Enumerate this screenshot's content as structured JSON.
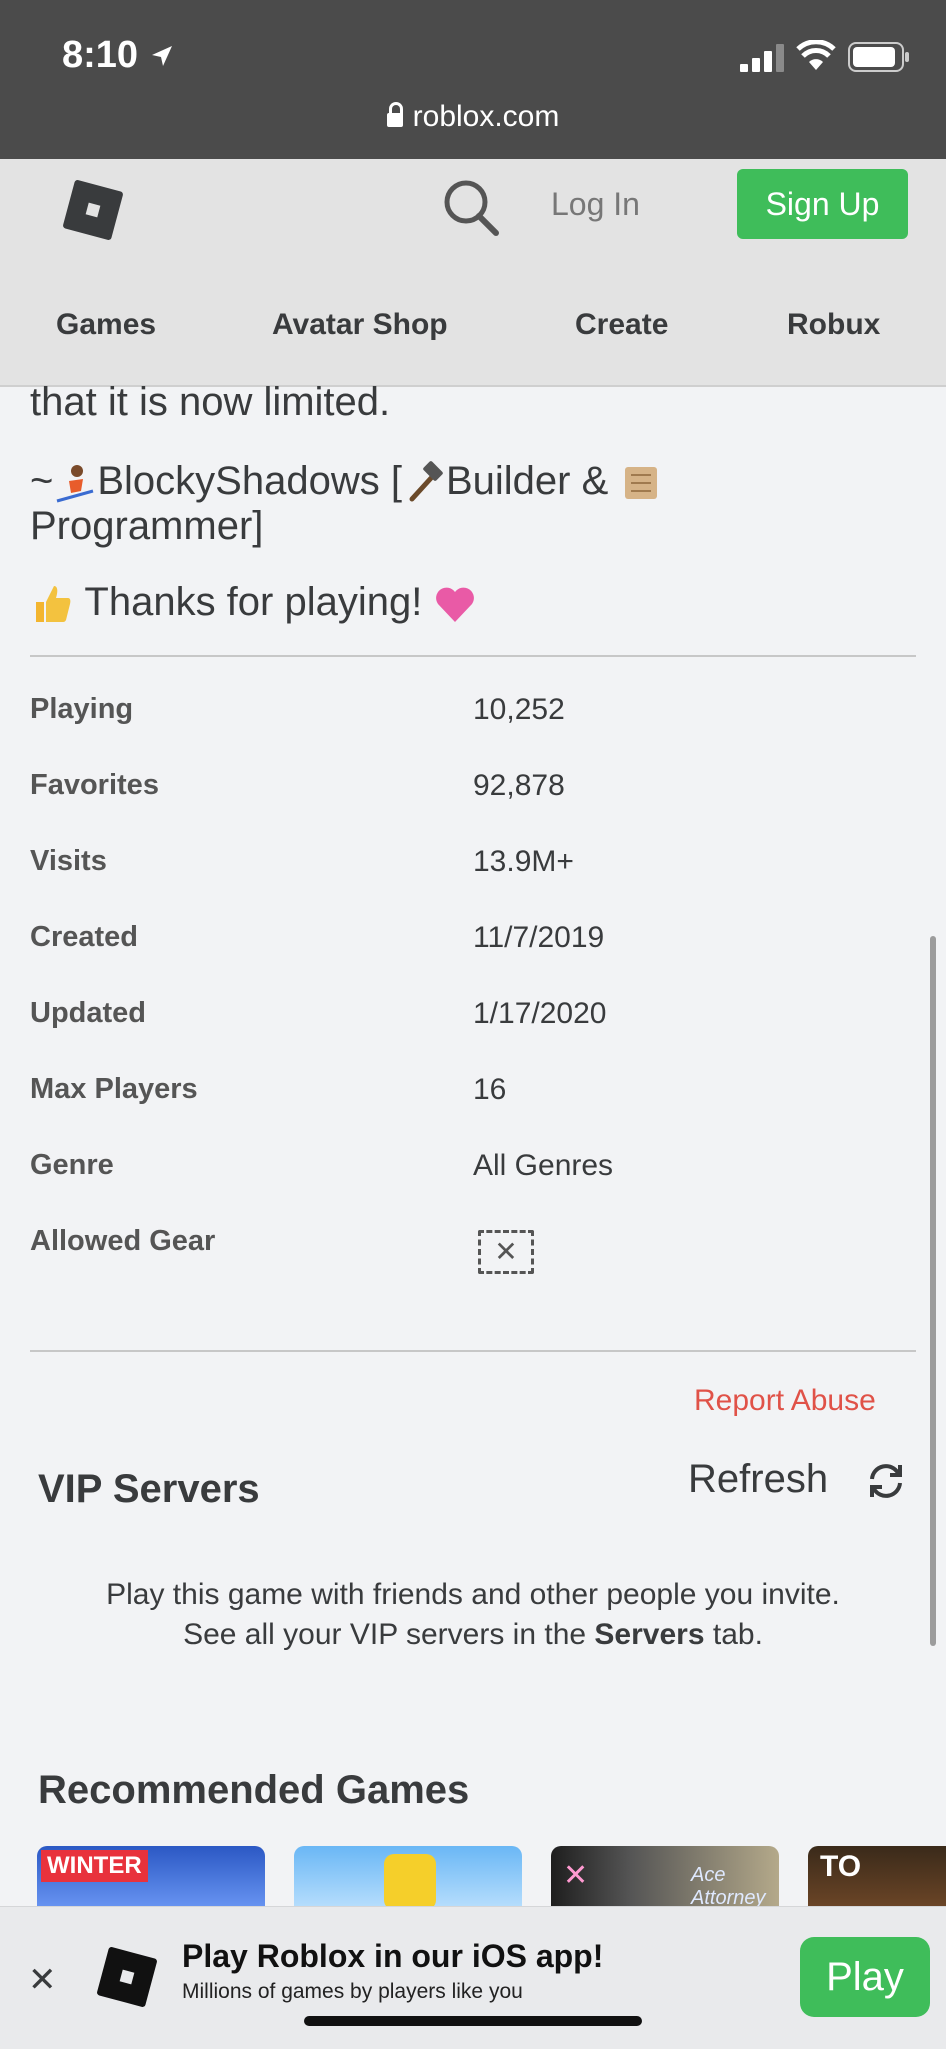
{
  "status_bar": {
    "time": "8:10"
  },
  "browser": {
    "url": "roblox.com"
  },
  "header": {
    "login_label": "Log In",
    "signup_label": "Sign Up",
    "nav": [
      "Games",
      "Avatar Shop",
      "Create",
      "Robux"
    ]
  },
  "description": {
    "line1": "that it is now limited.",
    "credit_prefix": "~",
    "credit_name": "BlockyShadows [",
    "credit_role1": "Builder & ",
    "credit_role2": "Programmer]",
    "thanks": "Thanks for playing!"
  },
  "stats": [
    {
      "label": "Playing",
      "value": "10,252"
    },
    {
      "label": "Favorites",
      "value": "92,878"
    },
    {
      "label": "Visits",
      "value": "13.9M+"
    },
    {
      "label": "Created",
      "value": "11/7/2019"
    },
    {
      "label": "Updated",
      "value": "1/17/2020"
    },
    {
      "label": "Max Players",
      "value": "16"
    },
    {
      "label": "Genre",
      "value": "All Genres"
    },
    {
      "label": "Allowed Gear",
      "value": ""
    }
  ],
  "report_abuse": "Report Abuse",
  "vip": {
    "title": "VIP Servers",
    "refresh": "Refresh",
    "desc1": "Play this game with friends and other people you invite.",
    "desc2_pre": "See all your VIP servers in the ",
    "desc2_bold": "Servers",
    "desc2_post": " tab."
  },
  "recommended": {
    "title": "Recommended Games",
    "thumb_texts": {
      "t1": "WINTER",
      "t3_x": "✕",
      "t3_ace": "Ace Attorney",
      "t4": "TO"
    }
  },
  "banner": {
    "close": "✕",
    "title": "Play Roblox in our iOS app!",
    "subtitle": "Millions of games by players like you",
    "play": "Play"
  },
  "colors": {
    "signup_green": "#3fbd5a",
    "report_red": "#e05248"
  }
}
